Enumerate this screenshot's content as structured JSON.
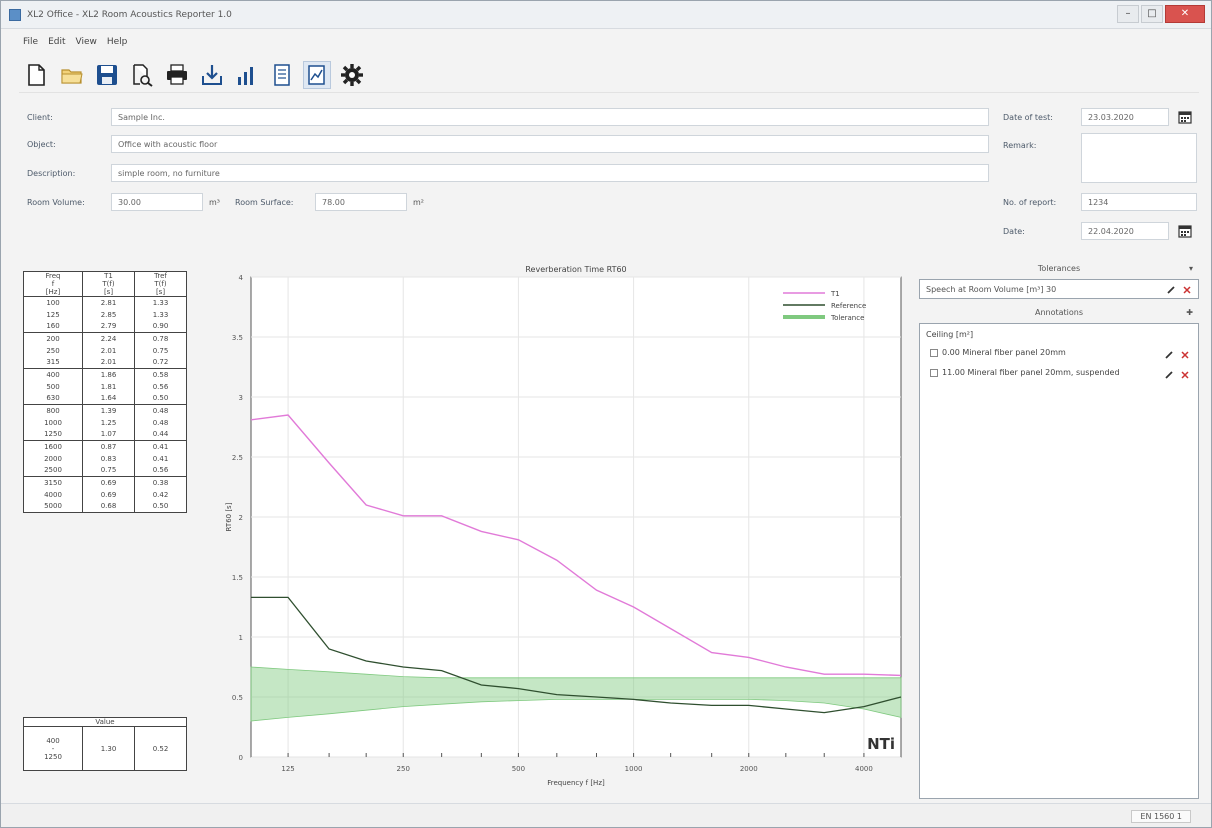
{
  "window": {
    "title": "XL2 Office - XL2 Room Acoustics Reporter 1.0",
    "minimize_glyph": "–",
    "maximize_glyph": "□",
    "close_glyph": "✕"
  },
  "menu": [
    "File",
    "Edit",
    "View",
    "Help"
  ],
  "toolbar": {
    "buttons": [
      "new-file-icon",
      "open-folder-icon",
      "save-icon",
      "print-preview-icon",
      "print-icon",
      "import-icon",
      "chart-icon",
      "notes-icon",
      "report-view-icon",
      "settings-icon"
    ],
    "accent": "#1e4f8f"
  },
  "form": {
    "client_label": "Client:",
    "client_value": "Sample Inc.",
    "object_label": "Object:",
    "object_value": "Office with acoustic floor",
    "description_label": "Description:",
    "description_value": "simple room, no furniture",
    "room_volume_label": "Room Volume:",
    "room_volume_value": "30.00",
    "room_volume_unit": "m³",
    "room_surface_label": "Room Surface:",
    "room_surface_value": "78.00",
    "room_surface_unit": "m²",
    "date_of_test_label": "Date of test:",
    "date_of_test_value": "23.03.2020",
    "remark_label": "Remark:",
    "report_no_label": "No. of report:",
    "report_no_value": "1234",
    "date_label": "Date:",
    "date_value": "22.04.2020"
  },
  "left_table": {
    "headers": [
      [
        "Freq",
        "f",
        "[Hz]"
      ],
      [
        "T1",
        "T(f)",
        "[s]"
      ],
      [
        "Tref",
        "T(f)",
        "[s]"
      ]
    ],
    "rows": [
      [
        "100",
        "2.81",
        "1.33"
      ],
      [
        "125",
        "2.85",
        "1.33"
      ],
      [
        "160",
        "2.79",
        "0.90"
      ],
      [
        "200",
        "2.24",
        "0.78"
      ],
      [
        "250",
        "2.01",
        "0.75"
      ],
      [
        "315",
        "2.01",
        "0.72"
      ],
      [
        "400",
        "1.86",
        "0.58"
      ],
      [
        "500",
        "1.81",
        "0.56"
      ],
      [
        "630",
        "1.64",
        "0.50"
      ],
      [
        "800",
        "1.39",
        "0.48"
      ],
      [
        "1000",
        "1.25",
        "0.48"
      ],
      [
        "1250",
        "1.07",
        "0.44"
      ],
      [
        "1600",
        "0.87",
        "0.41"
      ],
      [
        "2000",
        "0.83",
        "0.41"
      ],
      [
        "2500",
        "0.75",
        "0.56"
      ],
      [
        "3150",
        "0.69",
        "0.38"
      ],
      [
        "4000",
        "0.69",
        "0.42"
      ],
      [
        "5000",
        "0.68",
        "0.50"
      ]
    ]
  },
  "bottom_table": {
    "header": "Value",
    "range_from": "400",
    "range_dash": "-",
    "range_to": "1250",
    "t1": "1.30",
    "tref": "0.52"
  },
  "chart_data": {
    "type": "line",
    "title": "Reverberation Time RT60",
    "xlabel": "Frequency f [Hz]",
    "ylabel": "RT60 [s]",
    "x_scale": "log",
    "xlim": [
      100,
      5000
    ],
    "ylim": [
      0,
      4
    ],
    "x_ticks": [
      {
        "value": 125,
        "label": "125"
      },
      {
        "value": 250,
        "label": "250"
      },
      {
        "value": 500,
        "label": "500"
      },
      {
        "value": 1000,
        "label": "1000"
      },
      {
        "value": 2000,
        "label": "2000"
      },
      {
        "value": 4000,
        "label": "4000"
      }
    ],
    "y_ticks": [
      {
        "value": 0,
        "label": "0"
      },
      {
        "value": 0.5,
        "label": "0.5"
      },
      {
        "value": 1,
        "label": "1"
      },
      {
        "value": 1.5,
        "label": "1.5"
      },
      {
        "value": 2,
        "label": "2"
      },
      {
        "value": 2.5,
        "label": "2.5"
      },
      {
        "value": 3,
        "label": "3"
      },
      {
        "value": 3.5,
        "label": "3.5"
      },
      {
        "value": 4,
        "label": "4"
      }
    ],
    "grid": true,
    "legend_position": "top-right",
    "x": [
      100,
      125,
      160,
      200,
      250,
      315,
      400,
      500,
      630,
      800,
      1000,
      1250,
      1600,
      2000,
      2500,
      3150,
      4000,
      5000
    ],
    "series": [
      {
        "name": "T1",
        "color": "#e17ad8",
        "values": [
          2.81,
          2.85,
          2.45,
          2.1,
          2.01,
          2.01,
          1.88,
          1.81,
          1.64,
          1.39,
          1.25,
          1.07,
          0.87,
          0.83,
          0.75,
          0.69,
          0.69,
          0.68
        ]
      },
      {
        "name": "Reference",
        "color": "#2f4f2f",
        "values": [
          1.33,
          1.33,
          0.9,
          0.8,
          0.75,
          0.72,
          0.6,
          0.57,
          0.52,
          0.5,
          0.48,
          0.45,
          0.43,
          0.43,
          0.4,
          0.37,
          0.42,
          0.5
        ]
      },
      {
        "name": "Tolerance",
        "color": "#7fc97f",
        "upper": [
          0.75,
          0.73,
          0.71,
          0.69,
          0.67,
          0.66,
          0.66,
          0.66,
          0.66,
          0.66,
          0.66,
          0.66,
          0.66,
          0.66,
          0.66,
          0.66,
          0.66,
          0.66
        ],
        "lower": [
          0.3,
          0.33,
          0.36,
          0.39,
          0.42,
          0.44,
          0.46,
          0.47,
          0.48,
          0.48,
          0.48,
          0.48,
          0.48,
          0.48,
          0.47,
          0.45,
          0.4,
          0.33
        ]
      }
    ],
    "logo": "NTi"
  },
  "panel": {
    "tolerances_title": "Tolerances",
    "tolerance_value": "Speech at Room Volume [m³] 30",
    "annotations_title": "Annotations",
    "category": "Ceiling [m²]",
    "annotations": [
      {
        "text": "0.00 Mineral fiber panel 20mm"
      },
      {
        "text": "11.00 Mineral fiber panel 20mm, suspended"
      }
    ]
  },
  "status": {
    "text": "EN 1560 1"
  }
}
